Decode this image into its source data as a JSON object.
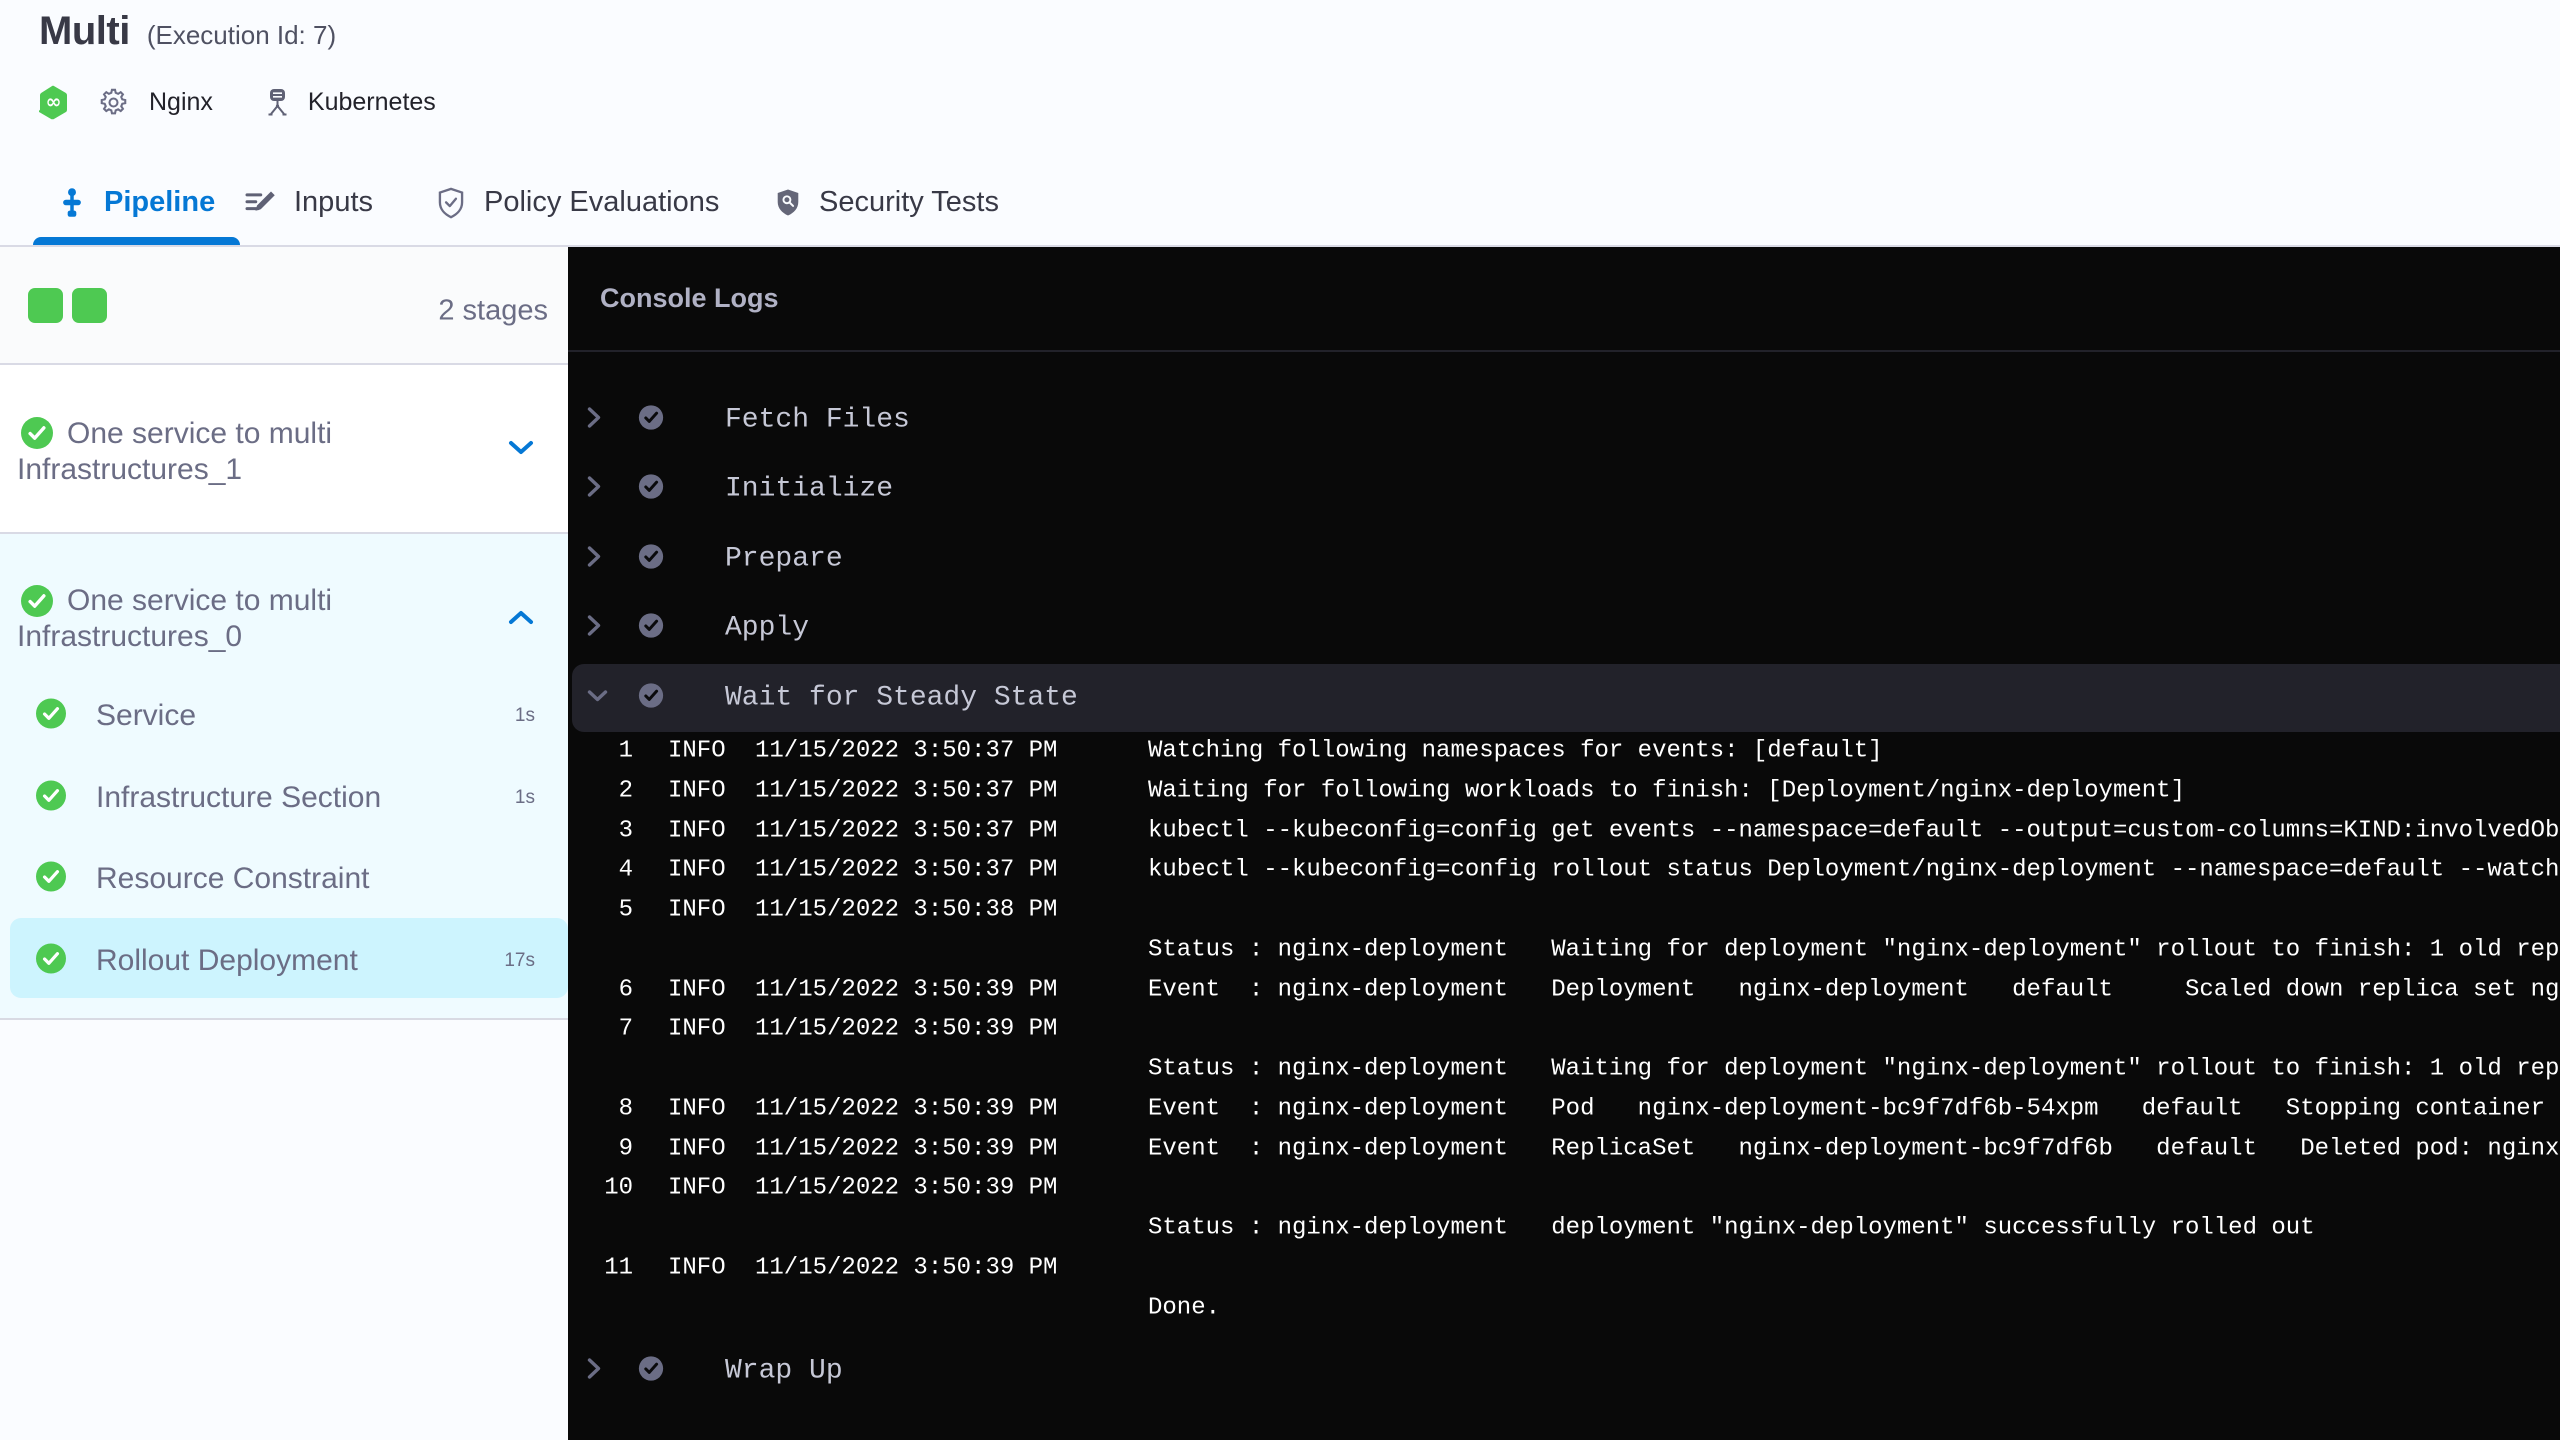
{
  "header": {
    "title": "Multi",
    "execution_id_label": "(Execution Id: 7)",
    "module_icon": "harness-cd-icon",
    "service": {
      "icon": "gear-icon",
      "label": "Nginx"
    },
    "infrastructure": {
      "icon": "kubernetes-icon",
      "label": "Kubernetes"
    }
  },
  "tabs": [
    {
      "label": "Pipeline",
      "icon": "pipeline-icon",
      "active": true
    },
    {
      "label": "Inputs",
      "icon": "inputs-icon",
      "active": false
    },
    {
      "label": "Policy Evaluations",
      "icon": "policy-evaluations-icon",
      "active": false
    },
    {
      "label": "Security Tests",
      "icon": "security-tests-icon",
      "active": false
    }
  ],
  "sidebar": {
    "status_squares": 2,
    "stage_count_label": "2 stages",
    "stages": [
      {
        "name_lines": [
          "One service to multi",
          "Infrastructures_1"
        ],
        "status": "success",
        "expanded": false,
        "steps": []
      },
      {
        "name_lines": [
          "One service to multi",
          "Infrastructures_0"
        ],
        "status": "success",
        "expanded": true,
        "steps": [
          {
            "name": "Service",
            "duration": "1s",
            "selected": false
          },
          {
            "name": "Infrastructure Section",
            "duration": "1s",
            "selected": false
          },
          {
            "name": "Resource Constraint",
            "duration": "",
            "selected": false
          },
          {
            "name": "Rollout Deployment",
            "duration": "17s",
            "selected": true
          }
        ]
      }
    ]
  },
  "console": {
    "title": "Console Logs",
    "steps": [
      {
        "name": "Fetch Files",
        "expanded": false
      },
      {
        "name": "Initialize",
        "expanded": false
      },
      {
        "name": "Prepare",
        "expanded": false
      },
      {
        "name": "Apply",
        "expanded": false
      },
      {
        "name": "Wait for Steady State",
        "expanded": true,
        "selected": true
      },
      {
        "name": "Wrap Up",
        "expanded": false
      }
    ],
    "logs": [
      {
        "num": "1",
        "level": "INFO",
        "time": "11/15/2022 3:50:37 PM",
        "msg": "Watching following namespaces for events: [default]"
      },
      {
        "num": "2",
        "level": "INFO",
        "time": "11/15/2022 3:50:37 PM",
        "msg": "Waiting for following workloads to finish: [Deployment/nginx-deployment]"
      },
      {
        "num": "3",
        "level": "INFO",
        "time": "11/15/2022 3:50:37 PM",
        "msg": "kubectl --kubeconfig=config get events --namespace=default --output=custom-columns=KIND:involvedOb"
      },
      {
        "num": "4",
        "level": "INFO",
        "time": "11/15/2022 3:50:37 PM",
        "msg": "kubectl --kubeconfig=config rollout status Deployment/nginx-deployment --namespace=default --watch"
      },
      {
        "num": "5",
        "level": "INFO",
        "time": "11/15/2022 3:50:38 PM",
        "msg": ""
      },
      {
        "num": "",
        "level": "",
        "time": "",
        "msg": "Status : nginx-deployment   Waiting for deployment \"nginx-deployment\" rollout to finish: 1 old rep"
      },
      {
        "num": "6",
        "level": "INFO",
        "time": "11/15/2022 3:50:39 PM",
        "msg": "Event  : nginx-deployment   Deployment   nginx-deployment   default     Scaled down replica set ng"
      },
      {
        "num": "7",
        "level": "INFO",
        "time": "11/15/2022 3:50:39 PM",
        "msg": ""
      },
      {
        "num": "",
        "level": "",
        "time": "",
        "msg": "Status : nginx-deployment   Waiting for deployment \"nginx-deployment\" rollout to finish: 1 old rep"
      },
      {
        "num": "8",
        "level": "INFO",
        "time": "11/15/2022 3:50:39 PM",
        "msg": "Event  : nginx-deployment   Pod   nginx-deployment-bc9f7df6b-54xpm   default   Stopping container "
      },
      {
        "num": "9",
        "level": "INFO",
        "time": "11/15/2022 3:50:39 PM",
        "msg": "Event  : nginx-deployment   ReplicaSet   nginx-deployment-bc9f7df6b   default   Deleted pod: nginx"
      },
      {
        "num": "10",
        "level": "INFO",
        "time": "11/15/2022 3:50:39 PM",
        "msg": ""
      },
      {
        "num": "",
        "level": "",
        "time": "",
        "msg": "Status : nginx-deployment   deployment \"nginx-deployment\" successfully rolled out"
      },
      {
        "num": "11",
        "level": "INFO",
        "time": "11/15/2022 3:50:39 PM",
        "msg": ""
      },
      {
        "num": "",
        "level": "",
        "time": "",
        "msg": "Done."
      }
    ]
  },
  "colors": {
    "accent_blue": "#0578d5",
    "success_green": "#42ba4b",
    "square_green": "#4ec952",
    "stage_section_bg": "#effbff",
    "selected_step_bg": "#cdf4fe",
    "console_bg": "#0a0a0c",
    "console_step_highlight": "#22222a"
  }
}
